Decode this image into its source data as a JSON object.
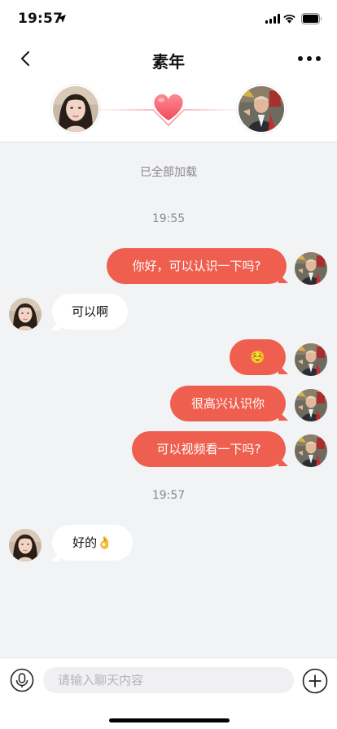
{
  "status_bar": {
    "time": "19:57"
  },
  "header": {
    "title": "素年"
  },
  "chat": {
    "load_notice": "已全部加载",
    "timestamps": [
      "19:55",
      "19:57"
    ],
    "messages": [
      {
        "side": "out",
        "text": "你好，可以认识一下吗?"
      },
      {
        "side": "in",
        "text": "可以啊"
      },
      {
        "side": "out",
        "text": "☺️"
      },
      {
        "side": "out",
        "text": "很高兴认识你"
      },
      {
        "side": "out",
        "text": "可以视频看一下吗?"
      },
      {
        "side": "in",
        "text": "好的👌"
      }
    ]
  },
  "composer": {
    "placeholder": "请输入聊天内容"
  },
  "colors": {
    "accent": "#ef5f4f",
    "background": "#f2f3f5"
  }
}
